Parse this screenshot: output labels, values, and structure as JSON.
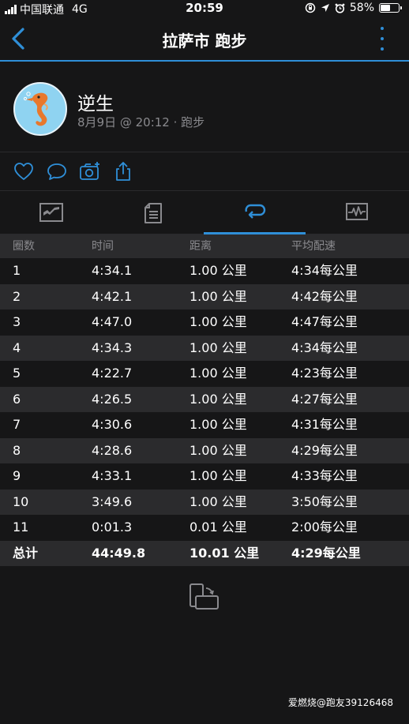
{
  "status_bar": {
    "carrier": "中国联通",
    "network": "4G",
    "time": "20:59",
    "battery": "58%",
    "battery_level": 0.58
  },
  "nav": {
    "title": "拉萨市 跑步",
    "accent_color": "#2f8fd8"
  },
  "profile": {
    "name": "逆生",
    "meta": "8月9日 @ 20:12 · 跑步"
  },
  "actions": [
    "like-icon",
    "comment-icon",
    "add-photo-icon",
    "share-icon"
  ],
  "tabs": [
    {
      "icon": "overview-chart-icon",
      "active": false
    },
    {
      "icon": "details-sheet-icon",
      "active": false
    },
    {
      "icon": "laps-icon",
      "active": true
    },
    {
      "icon": "activity-graph-icon",
      "active": false
    }
  ],
  "laps_table": {
    "headers": [
      "圈数",
      "时间",
      "距离",
      "平均配速"
    ],
    "rows": [
      [
        "1",
        "4:34.1",
        "1.00 公里",
        "4:34每公里"
      ],
      [
        "2",
        "4:42.1",
        "1.00 公里",
        "4:42每公里"
      ],
      [
        "3",
        "4:47.0",
        "1.00 公里",
        "4:47每公里"
      ],
      [
        "4",
        "4:34.3",
        "1.00 公里",
        "4:34每公里"
      ],
      [
        "5",
        "4:22.7",
        "1.00 公里",
        "4:23每公里"
      ],
      [
        "6",
        "4:26.5",
        "1.00 公里",
        "4:27每公里"
      ],
      [
        "7",
        "4:30.6",
        "1.00 公里",
        "4:31每公里"
      ],
      [
        "8",
        "4:28.6",
        "1.00 公里",
        "4:29每公里"
      ],
      [
        "9",
        "4:33.1",
        "1.00 公里",
        "4:33每公里"
      ],
      [
        "10",
        "3:49.6",
        "1.00 公里",
        "3:50每公里"
      ],
      [
        "11",
        "0:01.3",
        "0.01 公里",
        "2:00每公里"
      ]
    ],
    "total": [
      "总计",
      "44:49.8",
      "10.01 公里",
      "4:29每公里"
    ]
  },
  "watermark": "爱燃烧@跑友39126468"
}
